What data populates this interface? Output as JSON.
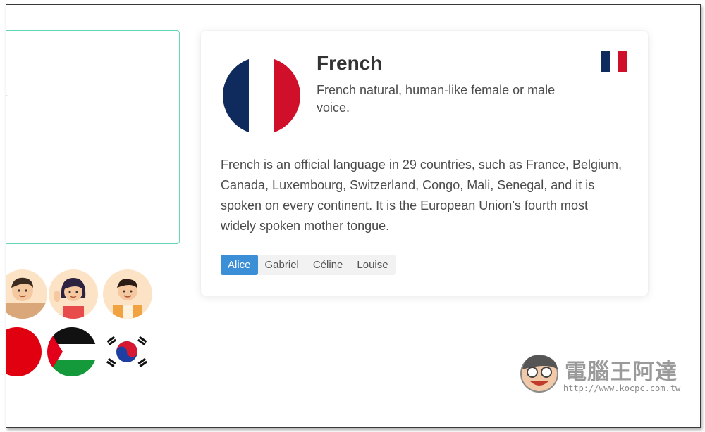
{
  "left_panel": {
    "ellipsis": "..."
  },
  "card": {
    "title": "French",
    "subtitle": "French natural, human-like female or male voice.",
    "description": "French is an official language in 29 countries, such as France, Belgium, Canada, Luxembourg, Switzerland, Congo, Mali, Senegal, and it is spoken on every continent. It is the European Union’s fourth most widely spoken mother tongue.",
    "voices": [
      {
        "label": "Alice",
        "selected": true
      },
      {
        "label": "Gabriel",
        "selected": false
      },
      {
        "label": "Céline",
        "selected": false
      },
      {
        "label": "Louise",
        "selected": false
      }
    ],
    "flag_colors": [
      "#0f2a5c",
      "#ffffff",
      "#d0102a"
    ]
  },
  "avatars": [
    {
      "icon": "man-avatar-icon"
    },
    {
      "icon": "woman-waving-avatar-icon"
    },
    {
      "icon": "man-smiling-avatar-icon"
    }
  ],
  "flags_row": [
    {
      "icon": "red-flag-icon"
    },
    {
      "icon": "palestine-flag-icon"
    },
    {
      "icon": "south-korea-flag-icon"
    }
  ],
  "watermark": {
    "name": "電腦王阿達",
    "url": "http://www.kocpc.com.tw"
  }
}
